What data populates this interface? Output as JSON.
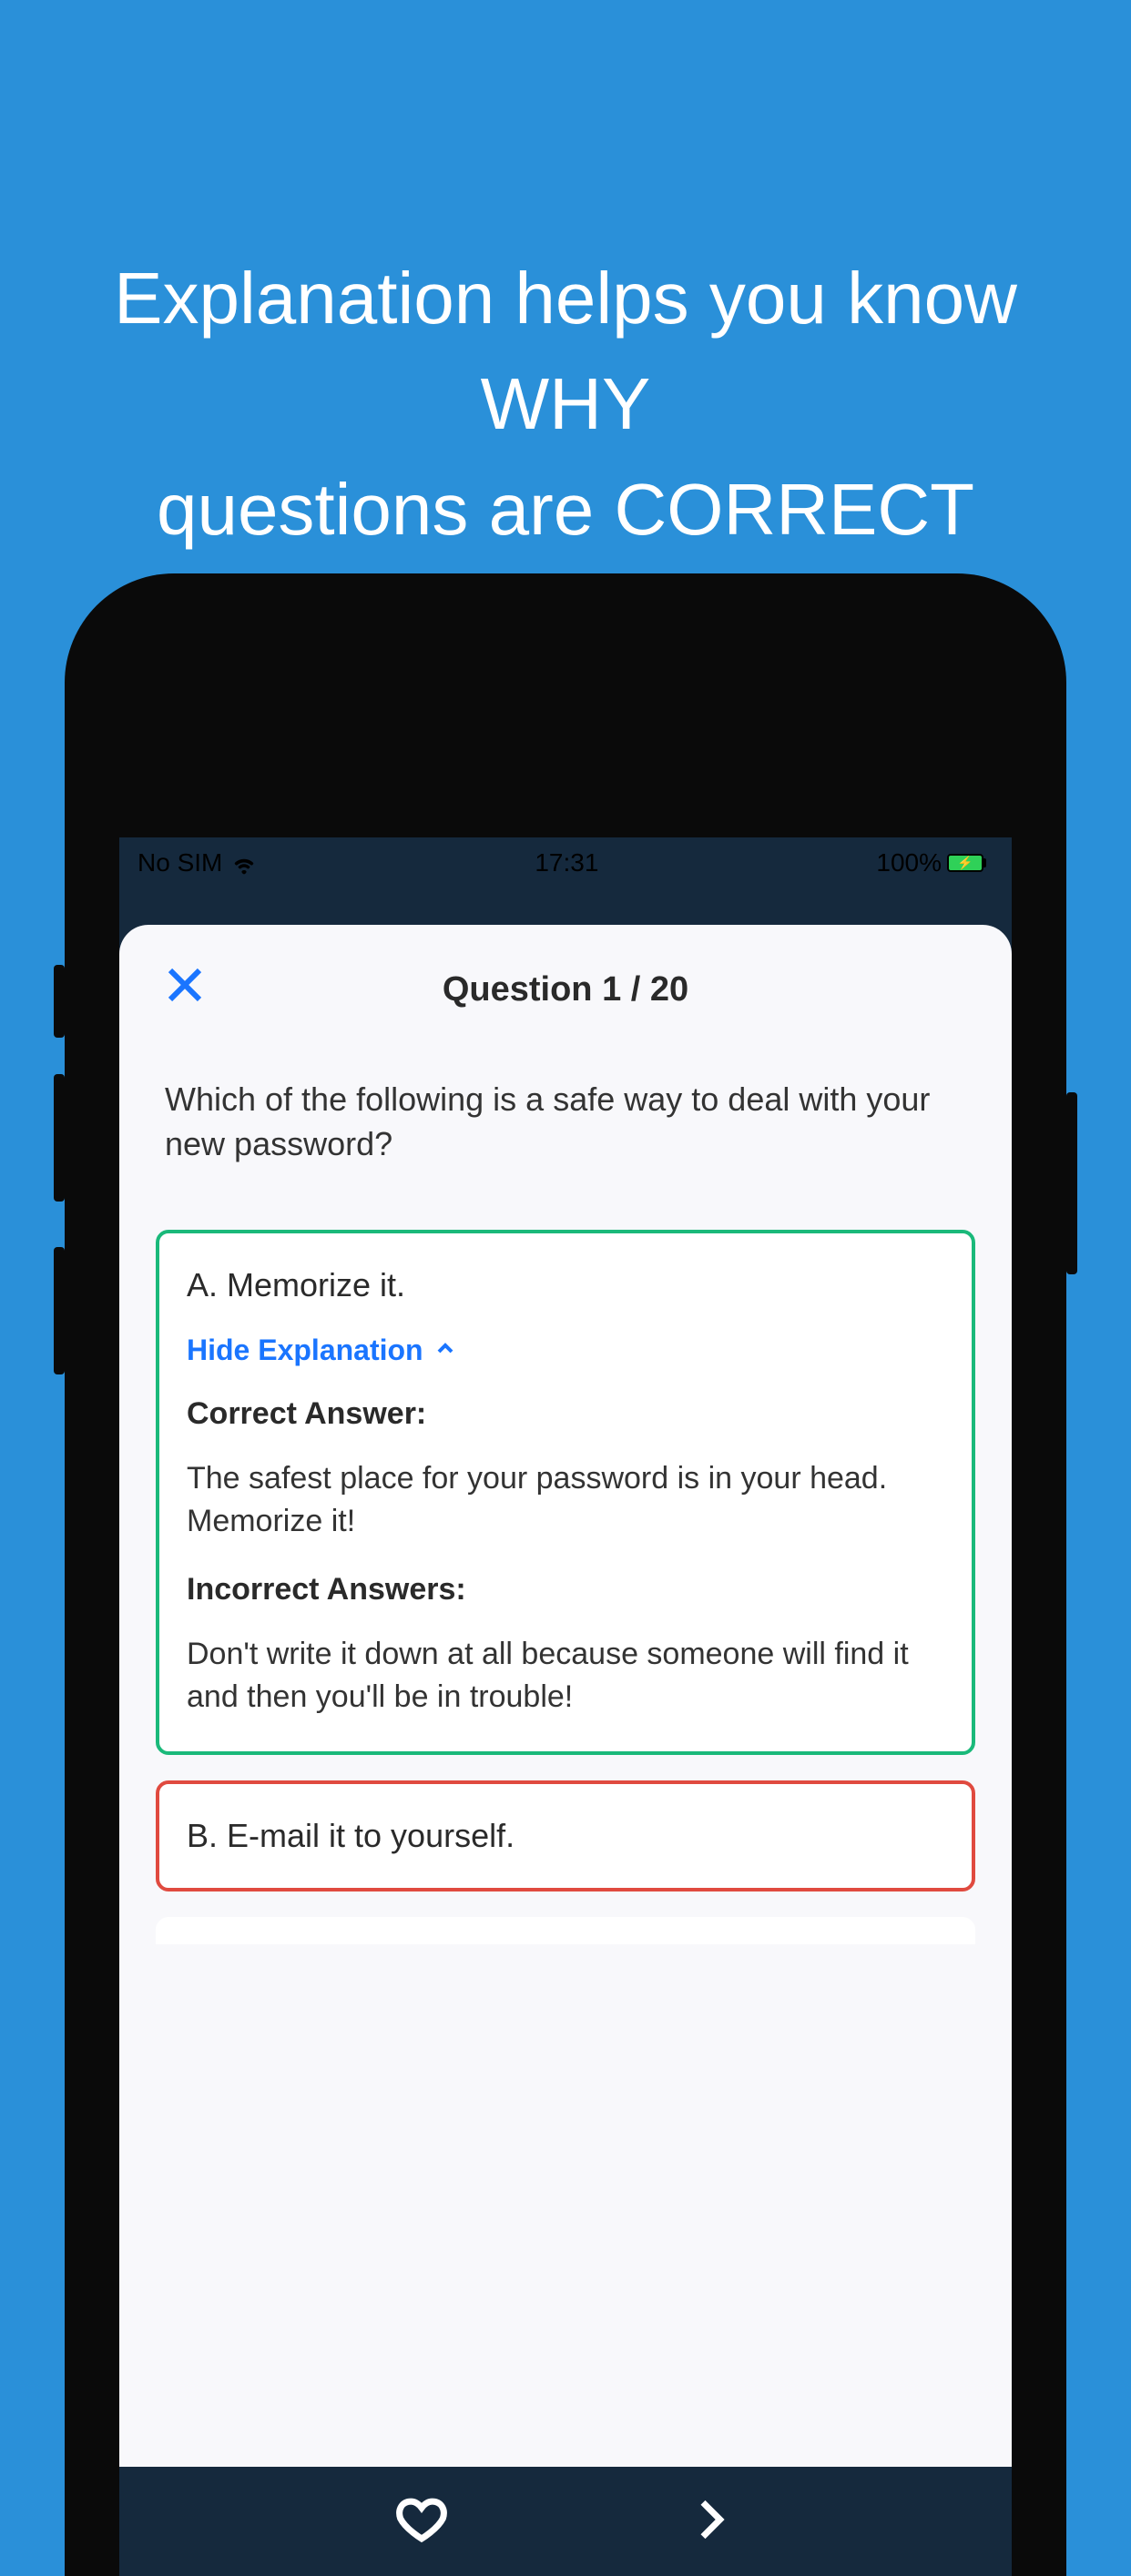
{
  "promo": {
    "line1": "Explanation helps you know WHY",
    "line2": "questions are CORRECT"
  },
  "statusBar": {
    "carrier": "No SIM",
    "time": "17:31",
    "battery": "100%"
  },
  "header": {
    "title": "Question 1 / 20"
  },
  "question": {
    "text": "Which of the following is a safe way to deal with your new password?"
  },
  "answers": {
    "a": {
      "label": "A. Memorize it.",
      "hideExplanation": "Hide Explanation",
      "correctHeading": "Correct Answer:",
      "correctText": "The safest place for your password is in your head. Memorize it!",
      "incorrectHeading": "Incorrect Answers:",
      "incorrectText": "Don't write it down at all because someone will find it and then you'll be in trouble!"
    },
    "b": {
      "label": "B. E-mail it to yourself."
    }
  }
}
